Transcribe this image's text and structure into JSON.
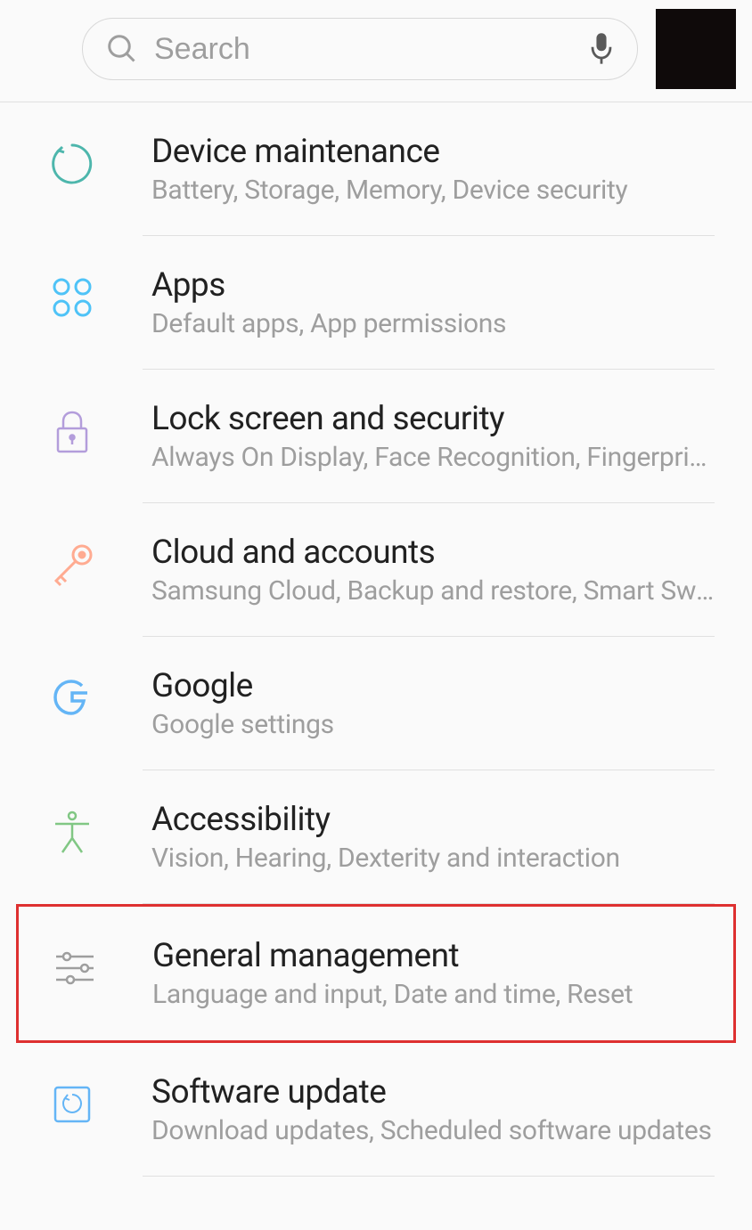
{
  "search": {
    "placeholder": "Search"
  },
  "items": [
    {
      "title": "Device maintenance",
      "subtitle": "Battery, Storage, Memory, Device security",
      "icon": "maintenance-icon",
      "color": "#4db6ac"
    },
    {
      "title": "Apps",
      "subtitle": "Default apps, App permissions",
      "icon": "apps-icon",
      "color": "#4fc3f7"
    },
    {
      "title": "Lock screen and security",
      "subtitle": "Always On Display, Face Recognition, Fingerprint scanner",
      "icon": "lock-icon",
      "color": "#b39ddb"
    },
    {
      "title": "Cloud and accounts",
      "subtitle": "Samsung Cloud, Backup and restore, Smart Switch",
      "icon": "key-icon",
      "color": "#ffab91"
    },
    {
      "title": "Google",
      "subtitle": "Google settings",
      "icon": "google-icon",
      "color": "#64b5f6"
    },
    {
      "title": "Accessibility",
      "subtitle": "Vision, Hearing, Dexterity and interaction",
      "icon": "accessibility-icon",
      "color": "#81c784"
    },
    {
      "title": "General management",
      "subtitle": "Language and input, Date and time, Reset",
      "icon": "sliders-icon",
      "color": "#9e9e9e",
      "highlighted": true
    },
    {
      "title": "Software update",
      "subtitle": "Download updates, Scheduled software updates",
      "icon": "update-icon",
      "color": "#64b5f6"
    }
  ]
}
